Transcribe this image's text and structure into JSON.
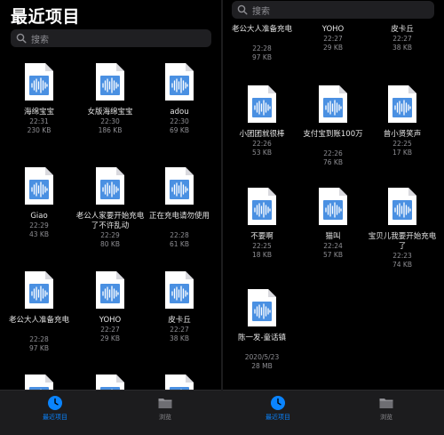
{
  "left": {
    "title": "最近项目",
    "search_placeholder": "搜索",
    "files": [
      {
        "name": "海绵宝宝",
        "time": "22:31",
        "size": "230 KB"
      },
      {
        "name": "女版海绵宝宝",
        "time": "22:30",
        "size": "186 KB"
      },
      {
        "name": "adou",
        "time": "22:30",
        "size": "69 KB"
      },
      {
        "name": "Giao",
        "time": "22:29",
        "size": "43 KB"
      },
      {
        "name": "老公人家要开始充电了不许乱动",
        "time": "22:29",
        "size": "80 KB"
      },
      {
        "name": "正在充电请勿使用",
        "time": "22:28",
        "size": "61 KB"
      },
      {
        "name": "老公大人准备充电",
        "time": "22:28",
        "size": "97 KB"
      },
      {
        "name": "YOHO",
        "time": "22:27",
        "size": "29 KB"
      },
      {
        "name": "皮卡丘",
        "time": "22:27",
        "size": "38 KB"
      }
    ]
  },
  "right": {
    "search_placeholder": "搜索",
    "top_partial": [
      {
        "name": "老公大人准备充电",
        "time": "22:28",
        "size": "97 KB"
      },
      {
        "name": "YOHO",
        "time": "22:27",
        "size": "29 KB"
      },
      {
        "name": "皮卡丘",
        "time": "22:27",
        "size": "38 KB"
      }
    ],
    "files": [
      {
        "name": "小团团就很棒",
        "time": "22:26",
        "size": "53 KB"
      },
      {
        "name": "支付宝到账100万",
        "time": "22:26",
        "size": "76 KB"
      },
      {
        "name": "曾小贤笑声",
        "time": "22:25",
        "size": "17 KB"
      },
      {
        "name": "不要啊",
        "time": "22:25",
        "size": "18 KB"
      },
      {
        "name": "猫叫",
        "time": "22:24",
        "size": "57 KB"
      },
      {
        "name": "宝贝儿我要开始充电了",
        "time": "22:23",
        "size": "74 KB"
      },
      {
        "name": "陈一发-童话镇",
        "time": "2020/5/23",
        "size": "28 MB"
      }
    ]
  },
  "tabbar": {
    "recents_label": "最近项目",
    "browse_label": "浏览"
  },
  "colors": {
    "accent": "#0a84ff",
    "background": "#000000",
    "doc_page": "#ffffff",
    "audio_wave": "#4a90e2"
  },
  "icons": {
    "file": "audio-file-icon",
    "search": "search-icon",
    "recents": "clock-icon",
    "browse": "folder-icon"
  }
}
